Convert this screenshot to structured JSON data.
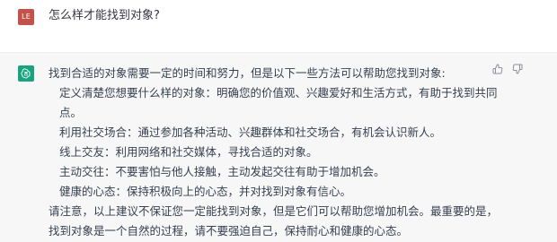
{
  "user": {
    "avatar_initials": "LE",
    "avatar_color": "#c2524a",
    "message": "怎么样才能找到对象?"
  },
  "assistant": {
    "avatar_icon": "openai-logo-icon",
    "avatar_color": "#19a37f",
    "intro": "找到合适的对象需要一定的时间和努力，但是以下一些方法可以帮助您找到对象:",
    "items": [
      "定义清楚您想要什么样的对象：明确您的价值观、兴趣爱好和生活方式，有助于找到共同点。",
      "利用社交场合：通过参加各种活动、兴趣群体和社交场合，有机会认识新人。",
      "线上交友：利用网络和社交媒体，寻找合适的对象。",
      "主动交往：不要害怕与他人接触，主动发起交往有助于增加机会。",
      "健康的心态：保持积极向上的心态，并对找到对象有信心。"
    ],
    "closing": "请注意，以上建议不保证您一定能找到对象，但是它们可以帮助您增加机会。最重要的是，找到对象是一个自然的过程，请不要强迫自己，保持耐心和健康的心态。"
  },
  "feedback": {
    "thumbs_up_icon": "thumbs-up-icon",
    "thumbs_down_icon": "thumbs-down-icon"
  }
}
